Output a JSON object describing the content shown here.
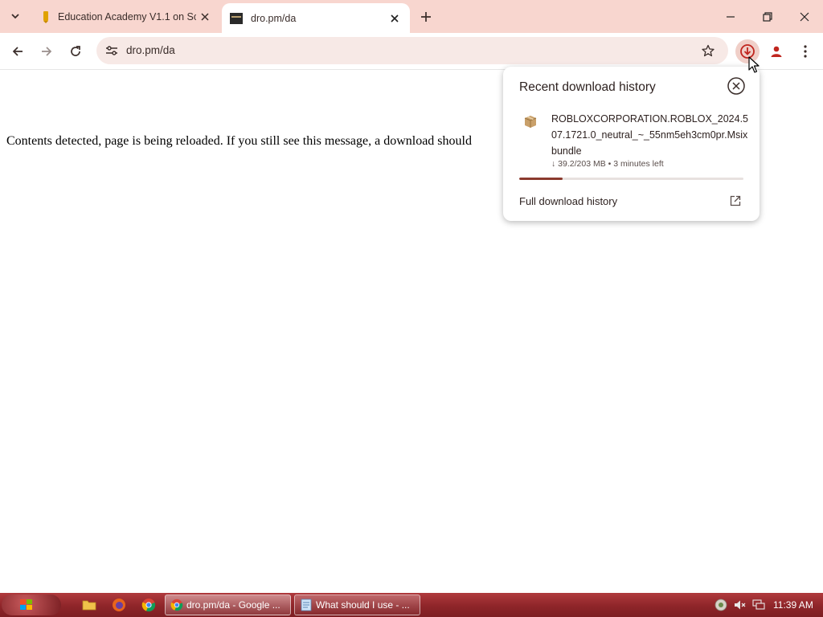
{
  "browser": {
    "tabs": [
      {
        "label": "Education Academy V1.1 on Sc",
        "active": false
      },
      {
        "label": "dro.pm/da",
        "active": true
      }
    ],
    "url": "dro.pm/da",
    "accent_color": "#f8d6cf"
  },
  "page": {
    "message": "Contents detected, page is being reloaded. If you still see this message, a download should"
  },
  "download_popup": {
    "title": "Recent download history",
    "file_name": "ROBLOXCORPORATION.ROBLOX_2024.507.1721.0_neutral_~_55nm5eh3cm0pr.Msixbundle",
    "status": "↓ 39.2/203 MB • 3 minutes left",
    "progress_fraction": 0.193,
    "full_history_label": "Full download history",
    "icons": [
      "close-icon",
      "package-icon",
      "open-external-icon"
    ]
  },
  "taskbar": {
    "items": [
      {
        "label": "dro.pm/da - Google ...",
        "icon": "chrome-icon",
        "active": true
      },
      {
        "label": "What should I use - ...",
        "icon": "notepad-icon",
        "active": false
      }
    ],
    "clock": "11:39 AM"
  }
}
